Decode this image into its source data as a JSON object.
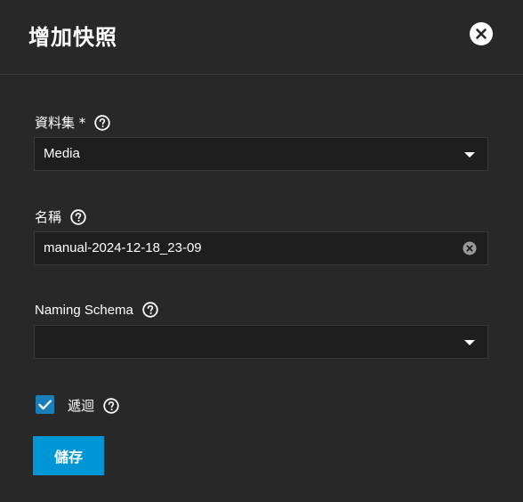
{
  "dialog": {
    "title": "增加快照",
    "close_icon": "close-icon"
  },
  "fields": {
    "dataset": {
      "label": "資料集 *",
      "value": "Media",
      "help_icon": "help-icon"
    },
    "name": {
      "label": "名稱",
      "value": "manual-2024-12-18_23-09",
      "help_icon": "help-icon"
    },
    "naming_schema": {
      "label": "Naming Schema",
      "value": "",
      "help_icon": "help-icon"
    },
    "recursive": {
      "label": "遞迴",
      "checked": true,
      "help_icon": "help-icon"
    }
  },
  "actions": {
    "save_label": "儲存"
  },
  "colors": {
    "background": "#282828",
    "input_background": "#1e1e1e",
    "accent": "#0095d5",
    "checkbox": "#1a7fb8"
  }
}
